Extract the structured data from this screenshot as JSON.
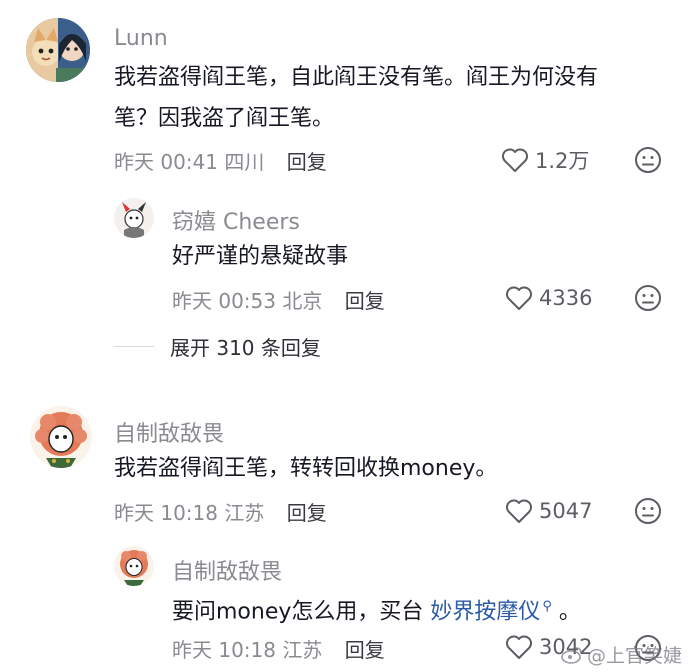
{
  "comments": [
    {
      "username": "Lunn",
      "text_line1": "我若盗得阎王笔，自此阎王没有笔。阎王为何没有",
      "text_line2": "笔？因我盗了阎王笔。",
      "meta": "昨天 00:41 四川",
      "reply_label": "回复",
      "likes": "1.2万",
      "replies": [
        {
          "username": "窃嬉 Cheers",
          "text": "好严谨的悬疑故事",
          "meta": "昨天 00:53 北京",
          "reply_label": "回复",
          "likes": "4336"
        }
      ],
      "expand_label": "展开 310 条回复"
    },
    {
      "username": "自制敌敌畏",
      "text": "我若盗得阎王笔，转转回收换money。",
      "meta": "昨天 10:18 江苏",
      "reply_label": "回复",
      "likes": "5047",
      "replies": [
        {
          "username": "自制敌敌畏",
          "text_prefix": "要问money怎么用，买台 ",
          "text_link": "妙界按摩仪",
          "text_suffix": " 。",
          "meta": "昨天 10:18 江苏",
          "reply_label": "回复",
          "likes": "3042"
        }
      ]
    }
  ],
  "watermark": "@上官笑婕",
  "icons": {
    "like": "heart-outline-icon",
    "dislike": "unhappy-face-icon",
    "search": "search-magnifier-icon"
  },
  "colors": {
    "username": "#8a8b91",
    "text": "#161823",
    "meta": "#8a8b91",
    "link": "#2a5aa8"
  }
}
